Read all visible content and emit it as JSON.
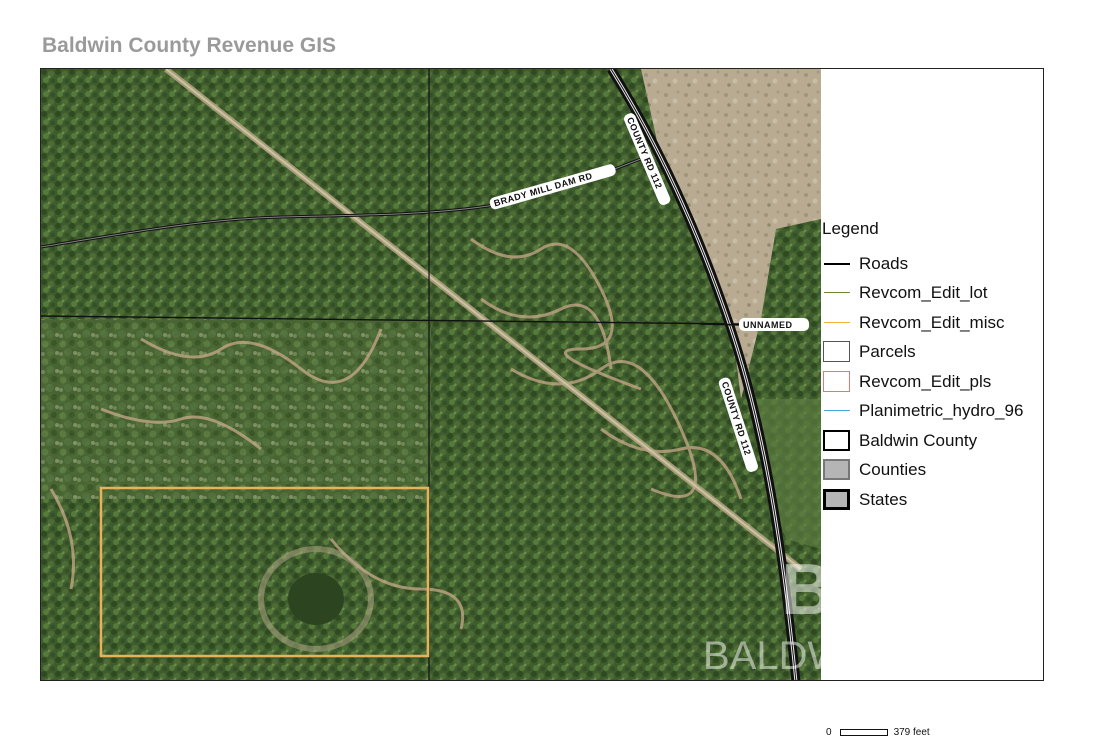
{
  "header": {
    "title": "Baldwin County Revenue GIS"
  },
  "map": {
    "road_labels": {
      "brady": "BRADY MILL DAM RD",
      "county_north": "COUNTY RD 112",
      "county_south": "COUNTY RD 112",
      "unnamed": "UNNAMED"
    },
    "watermark": {
      "monogram": "BR",
      "brand": "BALDWIN|MLS"
    },
    "colors": {
      "parcel_outline": "#e8b25a",
      "forest": "#3d5a2a",
      "cleared": "#b8a88c",
      "road": "#111111"
    }
  },
  "legend": {
    "title": "Legend",
    "items": [
      {
        "label": "Roads",
        "kind": "line",
        "color": "#000000",
        "weight": 2
      },
      {
        "label": "Revcom_Edit_lot",
        "kind": "line",
        "color": "#6b8a3a",
        "weight": 1
      },
      {
        "label": "Revcom_Edit_misc",
        "kind": "line",
        "color": "#f2b134",
        "weight": 1
      },
      {
        "label": "Parcels",
        "kind": "box",
        "border": "#555555",
        "fill": "#ffffff",
        "weight": 1
      },
      {
        "label": "Revcom_Edit_pls",
        "kind": "box",
        "border": "#e07a7a",
        "fill": "#ffffff",
        "weight": 1
      },
      {
        "label": "Planimetric_hydro_96",
        "kind": "line",
        "color": "#3fa9d8",
        "weight": 1
      },
      {
        "label": "Baldwin County",
        "kind": "box",
        "border": "#000000",
        "fill": "#ffffff",
        "weight": 2
      },
      {
        "label": "Counties",
        "kind": "box",
        "border": "#777777",
        "fill": "#b5b5b5",
        "weight": 2
      },
      {
        "label": "States",
        "kind": "box",
        "border": "#000000",
        "fill": "#b5b5b5",
        "weight": 3
      }
    ]
  },
  "scale": {
    "start": "0",
    "end": "379 feet"
  }
}
